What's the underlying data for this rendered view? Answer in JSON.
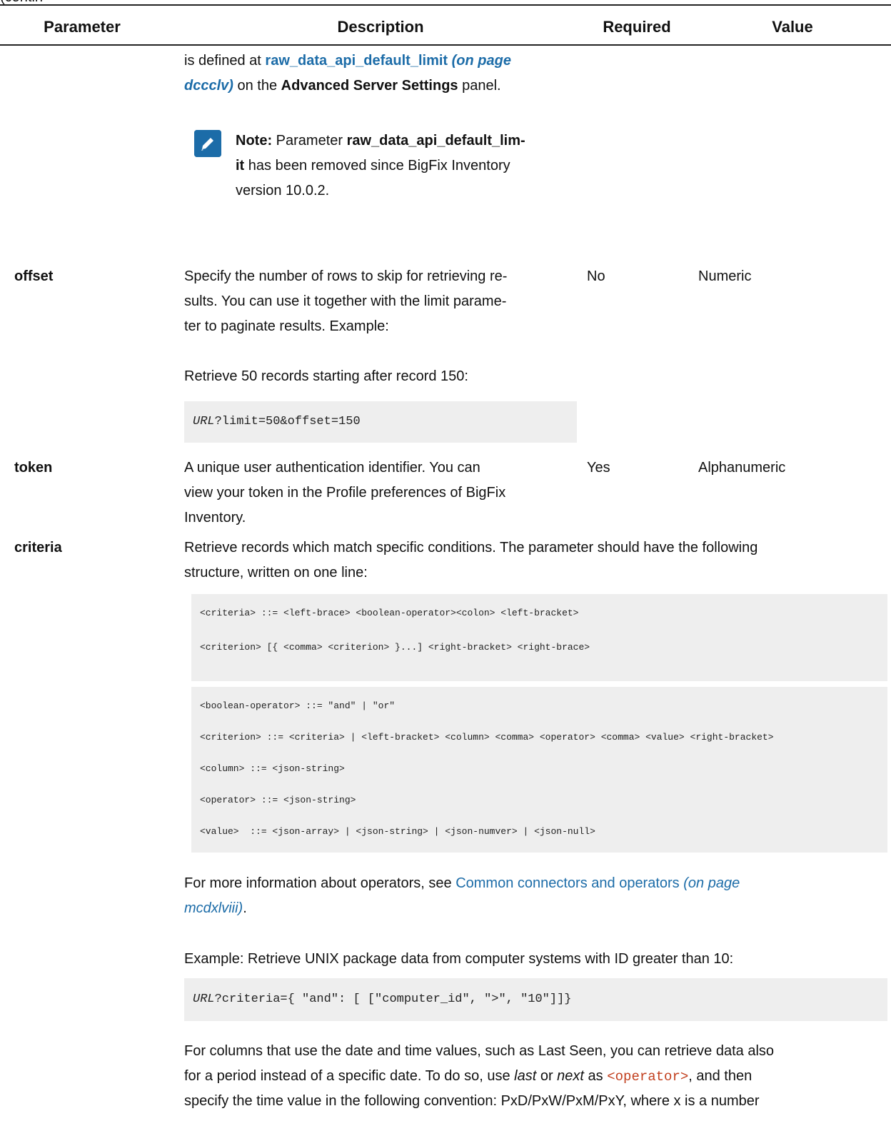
{
  "continued": "(continued)",
  "header": {
    "parameter": "Parameter",
    "description": "Description",
    "required": "Required",
    "value": "Value"
  },
  "limit_cont": {
    "line1_a": "is defined at ",
    "line1_link": "raw_data_api_default_limit",
    "line1_ital": " (on page",
    "line2_ital": "dccclv)",
    "line2_b": " on the ",
    "line2_bold": "Advanced Server Settings",
    "line2_c": " panel.",
    "note_label": "Note:",
    "note_line1_a": " Parameter ",
    "note_line1_bold": "raw_data_api_default_lim-",
    "note_line2_bold": "it",
    "note_line2_b": " has been removed since BigFix Inventory",
    "note_line3": "version 10.0.2."
  },
  "offset": {
    "name": "offset",
    "desc_lines": [
      "Specify the number of rows to skip for retrieving re-",
      "sults. You can use it together with the limit parame-",
      "ter to paginate results. Example:"
    ],
    "example_text": "Retrieve 50 records starting after record 150:",
    "code_ital": "URL",
    "code_rest": "?limit=50&offset=150",
    "required": "No",
    "value": "Numeric"
  },
  "token": {
    "name": "token",
    "desc_lines": [
      "A unique user authentication identifier. You can",
      "view your token in the Profile preferences of BigFix",
      "Inventory."
    ],
    "required": "Yes",
    "value": "Alphanumeric"
  },
  "criteria": {
    "name": "criteria",
    "desc_lines": [
      "Retrieve records which match specific conditions. The parameter should have the following",
      "structure, written on one line:"
    ],
    "code1": [
      "<criteria> ::= <left-brace> <boolean-operator><colon> <left-bracket>",
      "<criterion> [{ <comma> <criterion> }...] <right-bracket> <right-brace>"
    ],
    "code2": [
      "<boolean-operator> ::= \"and\" | \"or\"",
      "<criterion> ::= <criteria> | <left-bracket> <column> <comma> <operator> <comma> <value> <right-bracket>",
      "<column> ::= <json-string>",
      "<operator> ::= <json-string>",
      "<value>  ::= <json-array> | <json-string> | <json-numver> | <json-null>"
    ],
    "more_a": "For more information about operators, see ",
    "more_link": "Common connectors and operators",
    "more_ital1": " (on page",
    "more_ital2": "mcdxlviii)",
    "more_end": ".",
    "example_text": "Example: Retrieve UNIX package data from computer systems with ID greater than 10:",
    "code3_ital": "URL",
    "code3_rest": "?criteria={ \"and\": [ [\"computer_id\", \">\", \"10\"]]}",
    "final_1": "For columns that use the date and time values, such as Last Seen, you can retrieve data also",
    "final_2a": "for a period instead of a specific date. To do so, use ",
    "final_2_last": "last",
    "final_2_or": " or ",
    "final_2_next": "next",
    "final_2_as": " as ",
    "final_2_op": "<operator>",
    "final_2_end": ", and then",
    "final_3": "specify the time value in the following convention: PxD/PxW/PxM/PxY, where x is a number"
  }
}
